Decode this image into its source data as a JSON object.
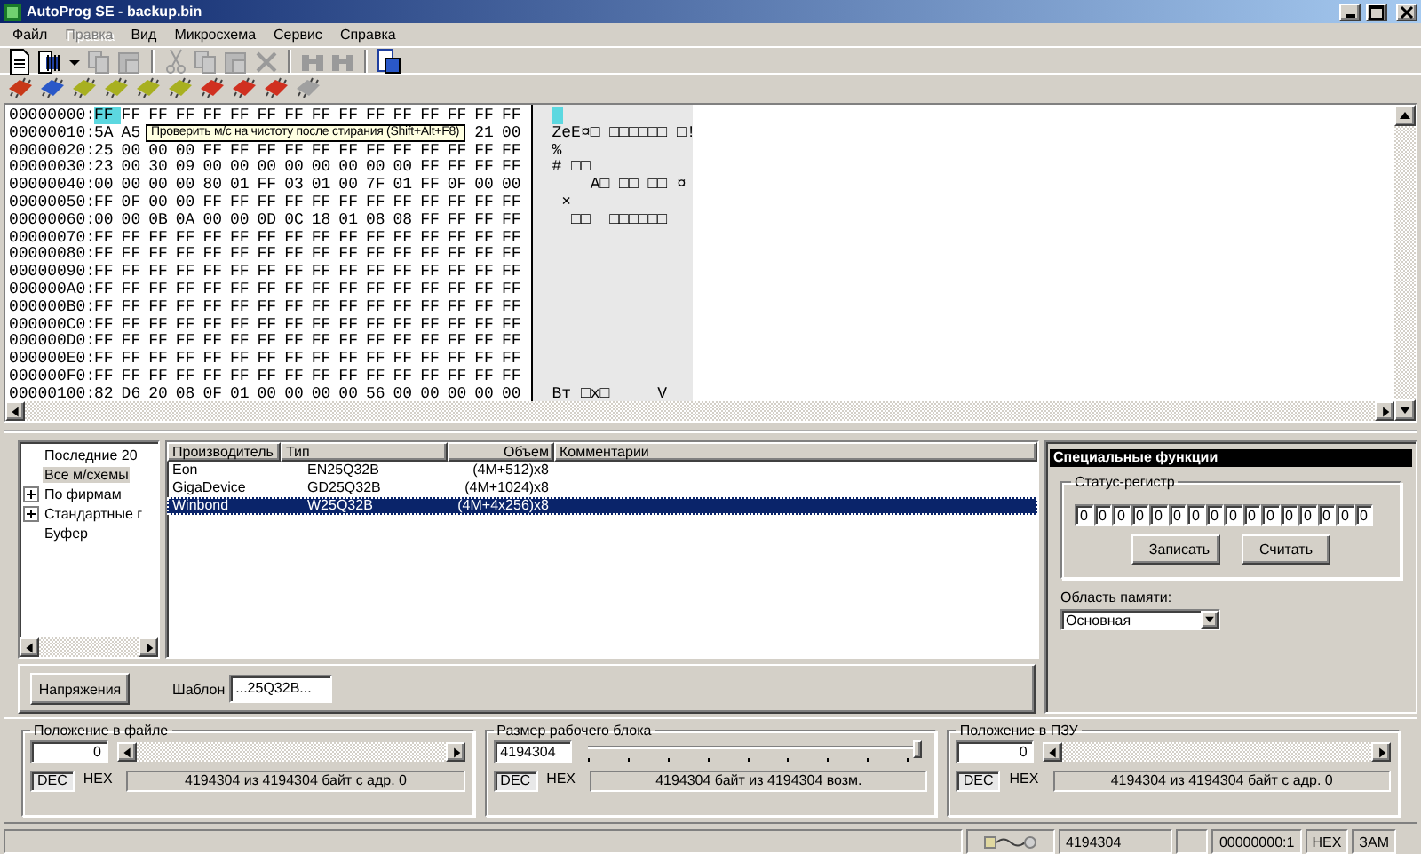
{
  "window": {
    "title": "AutoProg SE - backup.bin"
  },
  "menu": [
    {
      "label": "Файл",
      "disabled": false
    },
    {
      "label": "Правка",
      "disabled": true
    },
    {
      "label": "Вид",
      "disabled": false
    },
    {
      "label": "Микросхема",
      "disabled": false
    },
    {
      "label": "Сервис",
      "disabled": false
    },
    {
      "label": "Справка",
      "disabled": false
    }
  ],
  "toolbar_1": [
    {
      "kind": "new",
      "disabled": false
    },
    {
      "kind": "open",
      "disabled": false
    },
    {
      "kind": "dropdown",
      "disabled": false
    },
    {
      "kind": "copy",
      "disabled": true
    },
    {
      "kind": "paste",
      "disabled": true
    },
    {
      "kind": "separator"
    },
    {
      "kind": "cut",
      "disabled": true
    },
    {
      "kind": "copy",
      "disabled": true
    },
    {
      "kind": "paste",
      "disabled": true
    },
    {
      "kind": "delete",
      "disabled": true
    },
    {
      "kind": "separator"
    },
    {
      "kind": "find",
      "disabled": true
    },
    {
      "kind": "find",
      "disabled": true
    },
    {
      "kind": "separator"
    },
    {
      "kind": "info",
      "disabled": false
    }
  ],
  "toolbar_2": [
    {
      "color": "#c83818"
    },
    {
      "color": "#2a58c8"
    },
    {
      "color": "#a8b020"
    },
    {
      "color": "#a8b020"
    },
    {
      "color": "#a8b020"
    },
    {
      "color": "#a8b020"
    },
    {
      "color": "#d03020"
    },
    {
      "color": "#d03020"
    },
    {
      "color": "#d03020"
    },
    {
      "color": "#a0a0a0"
    }
  ],
  "hex_view": {
    "tooltip": "Проверить м/с на чистоту после стирания (Shift+Alt+F8)",
    "rows": [
      {
        "address": "00000000:",
        "bytes": [
          "FF",
          "FF",
          "FF",
          "FF",
          "FF",
          "FF",
          "FF",
          "FF",
          "FF",
          "FF",
          "FF",
          "FF",
          "FF",
          "FF",
          "FF",
          "FF"
        ],
        "cursor": true
      },
      {
        "address": "00000010:",
        "bytes": [
          "5A",
          "A5"
        ],
        "bytes_after_tooltip": [
          "21",
          "00"
        ],
        "ascii": "ZeE¤□ □□□□□□ □!",
        "cursor": false
      },
      {
        "address": "00000020:",
        "bytes": [
          "25",
          "00",
          "00",
          "00",
          "FF",
          "FF",
          "FF",
          "FF",
          "FF",
          "FF",
          "FF",
          "FF",
          "FF",
          "FF",
          "FF",
          "FF"
        ],
        "ascii": "%",
        "cursor": false
      },
      {
        "address": "00000030:",
        "bytes": [
          "23",
          "00",
          "30",
          "09",
          "00",
          "00",
          "00",
          "00",
          "00",
          "00",
          "00",
          "00",
          "FF",
          "FF",
          "FF",
          "FF"
        ],
        "ascii": "# □□",
        "cursor": false
      },
      {
        "address": "00000040:",
        "bytes": [
          "00",
          "00",
          "00",
          "00",
          "80",
          "01",
          "FF",
          "03",
          "01",
          "00",
          "7F",
          "01",
          "FF",
          "0F",
          "00",
          "00"
        ],
        "ascii": "    А□ □□ □□ ¤",
        "cursor": false
      },
      {
        "address": "00000050:",
        "bytes": [
          "FF",
          "0F",
          "00",
          "00",
          "FF",
          "FF",
          "FF",
          "FF",
          "FF",
          "FF",
          "FF",
          "FF",
          "FF",
          "FF",
          "FF",
          "FF"
        ],
        "ascii": " ×",
        "cursor": false
      },
      {
        "address": "00000060:",
        "bytes": [
          "00",
          "00",
          "0B",
          "0A",
          "00",
          "00",
          "0D",
          "0C",
          "18",
          "01",
          "08",
          "08",
          "FF",
          "FF",
          "FF",
          "FF"
        ],
        "ascii": "  □□  □□□□□□",
        "cursor": false
      },
      {
        "address": "00000070:",
        "bytes": [
          "FF",
          "FF",
          "FF",
          "FF",
          "FF",
          "FF",
          "FF",
          "FF",
          "FF",
          "FF",
          "FF",
          "FF",
          "FF",
          "FF",
          "FF",
          "FF"
        ],
        "cursor": false
      },
      {
        "address": "00000080:",
        "bytes": [
          "FF",
          "FF",
          "FF",
          "FF",
          "FF",
          "FF",
          "FF",
          "FF",
          "FF",
          "FF",
          "FF",
          "FF",
          "FF",
          "FF",
          "FF",
          "FF"
        ],
        "cursor": false
      },
      {
        "address": "00000090:",
        "bytes": [
          "FF",
          "FF",
          "FF",
          "FF",
          "FF",
          "FF",
          "FF",
          "FF",
          "FF",
          "FF",
          "FF",
          "FF",
          "FF",
          "FF",
          "FF",
          "FF"
        ],
        "cursor": false
      },
      {
        "address": "000000A0:",
        "bytes": [
          "FF",
          "FF",
          "FF",
          "FF",
          "FF",
          "FF",
          "FF",
          "FF",
          "FF",
          "FF",
          "FF",
          "FF",
          "FF",
          "FF",
          "FF",
          "FF"
        ],
        "cursor": false
      },
      {
        "address": "000000B0:",
        "bytes": [
          "FF",
          "FF",
          "FF",
          "FF",
          "FF",
          "FF",
          "FF",
          "FF",
          "FF",
          "FF",
          "FF",
          "FF",
          "FF",
          "FF",
          "FF",
          "FF"
        ],
        "cursor": false
      },
      {
        "address": "000000C0:",
        "bytes": [
          "FF",
          "FF",
          "FF",
          "FF",
          "FF",
          "FF",
          "FF",
          "FF",
          "FF",
          "FF",
          "FF",
          "FF",
          "FF",
          "FF",
          "FF",
          "FF"
        ],
        "cursor": false
      },
      {
        "address": "000000D0:",
        "bytes": [
          "FF",
          "FF",
          "FF",
          "FF",
          "FF",
          "FF",
          "FF",
          "FF",
          "FF",
          "FF",
          "FF",
          "FF",
          "FF",
          "FF",
          "FF",
          "FF"
        ],
        "cursor": false
      },
      {
        "address": "000000E0:",
        "bytes": [
          "FF",
          "FF",
          "FF",
          "FF",
          "FF",
          "FF",
          "FF",
          "FF",
          "FF",
          "FF",
          "FF",
          "FF",
          "FF",
          "FF",
          "FF",
          "FF"
        ],
        "cursor": false
      },
      {
        "address": "000000F0:",
        "bytes": [
          "FF",
          "FF",
          "FF",
          "FF",
          "FF",
          "FF",
          "FF",
          "FF",
          "FF",
          "FF",
          "FF",
          "FF",
          "FF",
          "FF",
          "FF",
          "FF"
        ],
        "cursor": false
      },
      {
        "address": "00000100:",
        "bytes": [
          "82",
          "D6",
          "20",
          "08",
          "0F",
          "01",
          "00",
          "00",
          "00",
          "00",
          "56",
          "00",
          "00",
          "00",
          "00",
          "00"
        ],
        "ascii": "Вт □х□     V",
        "cursor": false
      }
    ]
  },
  "chip_tree": [
    {
      "label": "Последние 20",
      "kind": "leaf",
      "selected": false
    },
    {
      "label": "Все м/схемы",
      "kind": "leaf",
      "selected": true
    },
    {
      "label": "По фирмам",
      "kind": "folder",
      "expanded": false,
      "selected": false
    },
    {
      "label": "Стандартные г",
      "kind": "folder",
      "expanded": false,
      "selected": false
    },
    {
      "label": "Буфер",
      "kind": "leaf",
      "selected": false
    }
  ],
  "chip_table": {
    "columns": [
      "Производитель",
      "Тип",
      "Объем",
      "Комментарии"
    ],
    "rows": [
      {
        "cells": [
          "Eon",
          "EN25Q32B",
          "(4M+512)x8"
        ],
        "selected": false
      },
      {
        "cells": [
          "GigaDevice",
          "GD25Q32B",
          "(4M+1024)x8"
        ],
        "selected": false
      },
      {
        "cells": [
          "Winbond",
          "W25Q32B",
          "(4M+4x256)x8"
        ],
        "selected": true
      }
    ]
  },
  "voltage_button": "Напряжения",
  "template": {
    "label": "Шаблон",
    "value": "...25Q32B..."
  },
  "special_functions": {
    "title": "Специальные функции",
    "status_register": {
      "label": "Статус-регистр",
      "bits": [
        "0",
        "0",
        "0",
        "0",
        "0",
        "0",
        "0",
        "0",
        "0",
        "0",
        "0",
        "0",
        "0",
        "0",
        "0",
        "0"
      ]
    },
    "write_button": "Записать",
    "read_button": "Считать",
    "memory_area": {
      "label": "Область памяти:",
      "value": "Основная"
    }
  },
  "positions": [
    {
      "kind": "scroll",
      "title": "Положение в файле",
      "value": "0",
      "radix": [
        {
          "label": "DEC",
          "selected": true
        },
        {
          "label": "HEX",
          "selected": false
        }
      ],
      "info": "4194304 из 4194304 байт с адр. 0"
    },
    {
      "kind": "slider",
      "title": "Размер рабочего блока",
      "value": "4194304",
      "level": 1,
      "radix": [
        {
          "label": "DEC",
          "selected": true
        },
        {
          "label": "HEX",
          "selected": false
        }
      ],
      "info": "4194304 байт из 4194304 возм."
    },
    {
      "kind": "scroll",
      "title": "Положение в ПЗУ",
      "value": "0",
      "radix": [
        {
          "label": "DEC",
          "selected": true
        },
        {
          "label": "HEX",
          "selected": false
        }
      ],
      "info": "4194304 из 4194304 байт с адр. 0"
    }
  ],
  "status_bar": {
    "fields": [
      "4194304",
      "00000000:1",
      "HEX",
      "ЗАМ"
    ]
  }
}
